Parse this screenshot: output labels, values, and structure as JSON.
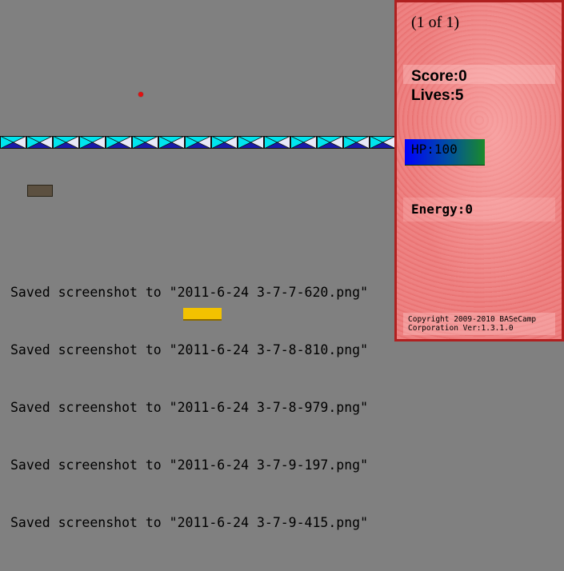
{
  "game": {
    "bricks": {
      "count": 15,
      "colors": {
        "primary": "#00e5ee",
        "secondary": "#1a1aaa",
        "highlight": "#ffffff"
      }
    },
    "ball": {
      "color": "#e31010"
    },
    "paddle": {
      "color": "#5c5040"
    }
  },
  "log": {
    "lines": [
      "Saved screenshot to \"2011-6-24 3-7-7-620.png\"",
      "Saved screenshot to \"2011-6-24 3-7-8-810.png\"",
      "Saved screenshot to \"2011-6-24 3-7-8-979.png\"",
      "Saved screenshot to \"2011-6-24 3-7-9-197.png\"",
      "Saved screenshot to \"2011-6-24 3-7-9-415.png\""
    ]
  },
  "sidebar": {
    "page_indicator": "(1 of 1)",
    "score": "Score:0",
    "lives": "Lives:5",
    "hp": "HP:100",
    "hp_level": 1.0,
    "energy": "Energy:0",
    "copyright": "Copyright 2009-2010 BASeCamp Corporation Ver:1.3.1.0",
    "colors": {
      "background": "#ec7474",
      "border": "#b02020",
      "hp_start": "#0000ff",
      "hp_end": "#1a8a2a"
    }
  }
}
